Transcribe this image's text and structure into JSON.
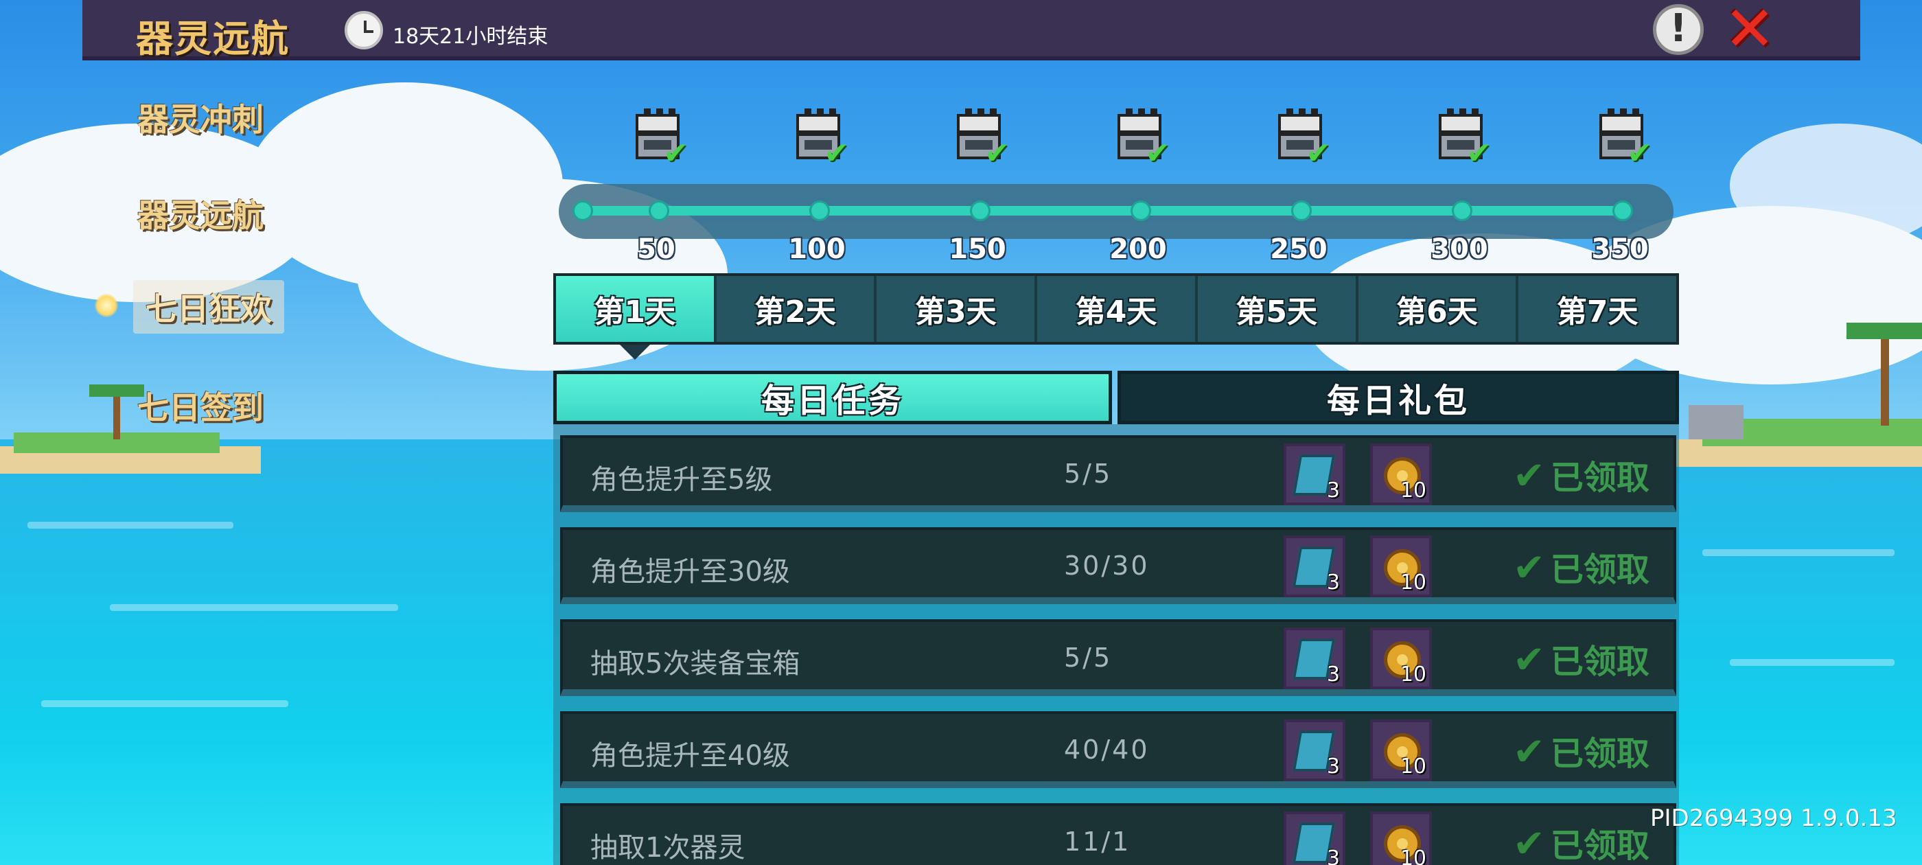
{
  "header": {
    "title": "器灵远航",
    "timer": "18天21小时结束"
  },
  "sidebar": {
    "items": [
      {
        "label": "器灵冲刺"
      },
      {
        "label": "器灵远航"
      },
      {
        "label": "七日狂欢"
      },
      {
        "label": "七日签到"
      }
    ],
    "active_index": 2
  },
  "milestones": [
    {
      "value": "50",
      "claimed": true
    },
    {
      "value": "100",
      "claimed": true
    },
    {
      "value": "150",
      "claimed": true
    },
    {
      "value": "200",
      "claimed": true
    },
    {
      "value": "250",
      "claimed": true
    },
    {
      "value": "300",
      "claimed": true
    },
    {
      "value": "350",
      "claimed": true
    }
  ],
  "progress_fraction": 1.0,
  "day_tabs": [
    "第1天",
    "第2天",
    "第3天",
    "第4天",
    "第5天",
    "第6天",
    "第7天"
  ],
  "active_day": 0,
  "sub_tabs": {
    "daily_tasks": "每日任务",
    "daily_gift": "每日礼包"
  },
  "tasks": [
    {
      "name": "角色提升至5级",
      "progress": "5/5",
      "rewards": [
        {
          "icon": "gem-card-icon",
          "qty": "3"
        },
        {
          "icon": "gold-coin-icon",
          "qty": "10"
        }
      ],
      "status": "已领取"
    },
    {
      "name": "角色提升至30级",
      "progress": "30/30",
      "rewards": [
        {
          "icon": "gem-card-icon",
          "qty": "3"
        },
        {
          "icon": "gold-coin-icon",
          "qty": "10"
        }
      ],
      "status": "已领取"
    },
    {
      "name": "抽取5次装备宝箱",
      "progress": "5/5",
      "rewards": [
        {
          "icon": "gem-card-icon",
          "qty": "3"
        },
        {
          "icon": "gold-coin-icon",
          "qty": "10"
        }
      ],
      "status": "已领取"
    },
    {
      "name": "角色提升至40级",
      "progress": "40/40",
      "rewards": [
        {
          "icon": "gem-card-icon",
          "qty": "3"
        },
        {
          "icon": "gold-coin-icon",
          "qty": "10"
        }
      ],
      "status": "已领取"
    },
    {
      "name": "抽取1次器灵",
      "progress": "11/1",
      "rewards": [
        {
          "icon": "gem-card-icon",
          "qty": "3"
        },
        {
          "icon": "gold-coin-icon",
          "qty": "10"
        }
      ],
      "status": "已领取"
    }
  ],
  "footer": {
    "pid": "PID2694399 1.9.0.13"
  },
  "colors": {
    "accent": "#36d2c0",
    "title_gold": "#f1c56b",
    "claimed_green": "#3c9a4e",
    "close_red": "#e82b20"
  }
}
